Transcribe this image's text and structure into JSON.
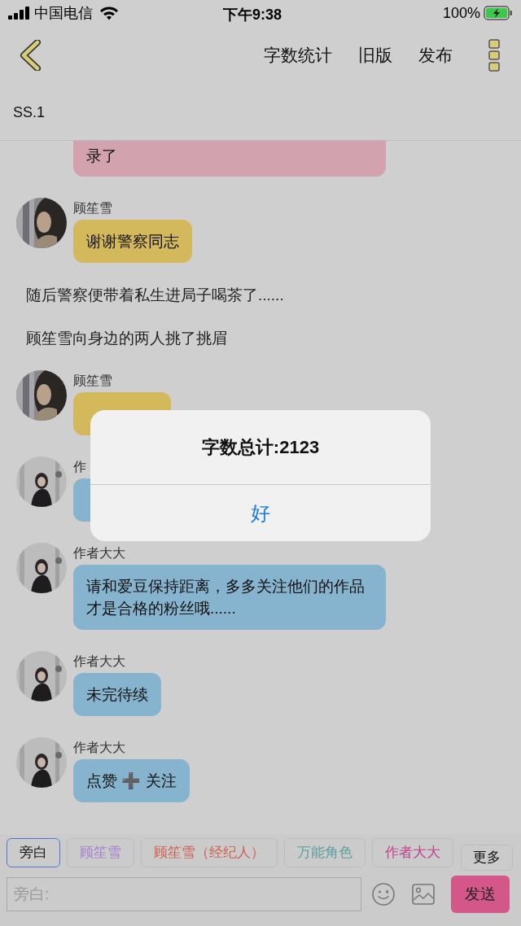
{
  "status_bar": {
    "carrier": "中国电信",
    "time": "下午9:38",
    "battery": "100%"
  },
  "nav": {
    "actions": [
      "字数统计",
      "旧版",
      "发布"
    ]
  },
  "chapter": "SS.1",
  "messages": [
    {
      "kind": "bubble",
      "lines": "录了",
      "color": "#d2a3ae",
      "continued": true
    },
    {
      "kind": "bubble",
      "speaker": "顾笙雪",
      "avatar": {
        "kind": "picture",
        "dark": true
      },
      "lines": "谢谢警察同志",
      "color": "#d3b95c"
    },
    {
      "kind": "narration",
      "lines": "随后警察便带着私生进局子喝茶了......"
    },
    {
      "kind": "narration",
      "lines": "顾笙雪向身边的两人挑了挑眉"
    },
    {
      "kind": "bubble",
      "speaker": "顾笙雪",
      "avatar": {
        "kind": "picture",
        "dark": true
      },
      "color": "#d3b95c"
    },
    {
      "kind": "bubble",
      "speaker": "作",
      "avatar": {
        "kind": "picture",
        "dark": false
      },
      "color": "#86b3cd"
    },
    {
      "kind": "bubble",
      "speaker": "作者大大",
      "avatar": {
        "kind": "picture",
        "dark": false
      },
      "lines": "请和爱豆保持距离，多多关注他们的作品才是合格的粉丝哦......",
      "color": "#86b3cd"
    },
    {
      "kind": "bubble",
      "speaker": "作者大大",
      "avatar": {
        "kind": "picture",
        "dark": false
      },
      "lines": "未完待续",
      "color": "#86b3cd"
    },
    {
      "kind": "bubble",
      "speaker": "作者大大",
      "avatar": {
        "kind": "picture",
        "dark": false
      },
      "lines": "点赞 ➕ 关注",
      "color": "#86b3cd"
    }
  ],
  "dialog": {
    "title": "字数总计:2123",
    "button": "好"
  },
  "roles": [
    {
      "label": "旁白",
      "selected": true,
      "color": "#1a1a1a"
    },
    {
      "label": "顾笙雪",
      "selected": false,
      "color": "#a57fcf"
    },
    {
      "label": "顾笙雪（经纪人）",
      "selected": false,
      "color": "#cf5f52"
    },
    {
      "label": "万能角色",
      "selected": false,
      "color": "#5c9fa0"
    },
    {
      "label": "作者大大",
      "selected": false,
      "color": "#c23f8c"
    }
  ],
  "more_button": "更多",
  "input": {
    "placeholder": "旁白:"
  },
  "send_button": "发送"
}
